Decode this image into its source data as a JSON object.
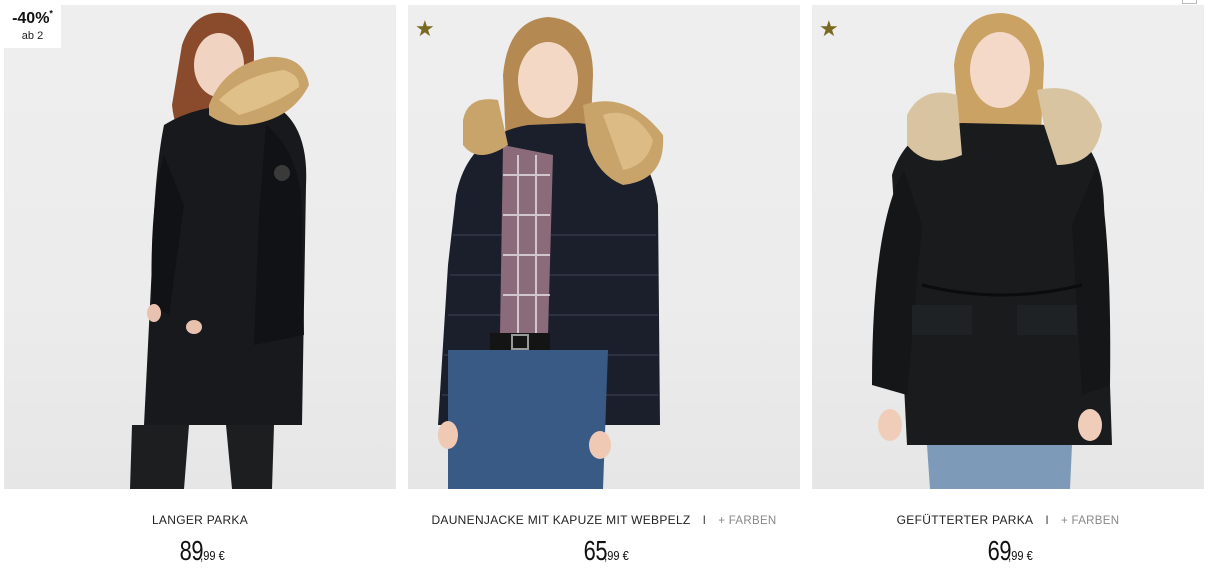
{
  "products": [
    {
      "name": "LANGER PARKA",
      "more_colors": "",
      "price_euros": "89",
      "price_cents": ",99 €",
      "badge": {
        "discount": "-40%",
        "asterisk": "*",
        "condition": "ab 2"
      },
      "favorite": false
    },
    {
      "name": "DAUNENJACKE MIT KAPUZE MIT WEBPELZ",
      "more_colors": "+ FARBEN",
      "separator": "I",
      "price_euros": "65",
      "price_cents": ",99 €",
      "favorite": true,
      "favorite_icon": "star-icon"
    },
    {
      "name": "GEFÜTTERTER PARKA",
      "more_colors": "+ FARBEN",
      "separator": "I",
      "price_euros": "69",
      "price_cents": ",99 €",
      "favorite": true,
      "favorite_icon": "star-icon"
    }
  ],
  "colors": {
    "star": "#7a6a1f",
    "photo_bg": "#eeeeee",
    "jacket": "#16181c",
    "fur": "#c9a46a"
  }
}
